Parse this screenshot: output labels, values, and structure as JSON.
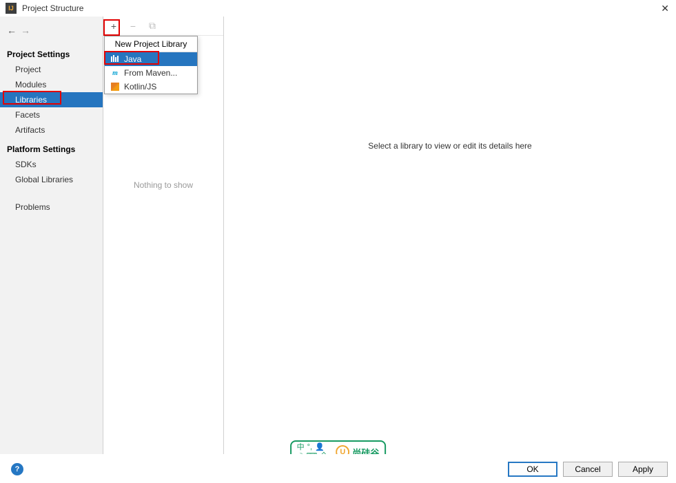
{
  "window": {
    "icon_text": "IJ",
    "title": "Project Structure",
    "close_glyph": "✕"
  },
  "nav": {
    "back_glyph": "←",
    "forward_glyph": "→"
  },
  "sidebar": {
    "section1": "Project Settings",
    "items1": [
      "Project",
      "Modules",
      "Libraries",
      "Facets",
      "Artifacts"
    ],
    "section2": "Platform Settings",
    "items2": [
      "SDKs",
      "Global Libraries"
    ],
    "section3_item": "Problems"
  },
  "toolbar": {
    "add_glyph": "+",
    "remove_glyph": "−",
    "copy_glyph": "⧉"
  },
  "middle": {
    "empty": "Nothing to show"
  },
  "popup": {
    "header": "New Project Library",
    "items": [
      {
        "label": "Java",
        "icon": "java"
      },
      {
        "label": "From Maven...",
        "icon": "maven"
      },
      {
        "label": "Kotlin/JS",
        "icon": "kotlin"
      }
    ]
  },
  "detail": {
    "placeholder": "Select a library to view or edit its details here"
  },
  "footer": {
    "help_glyph": "?",
    "ok": "OK",
    "cancel": "Cancel",
    "apply": "Apply"
  },
  "watermark": {
    "line1a": "中",
    "line1b": "°,",
    "line1c": "👤",
    "line2a": "☽",
    "line2b": "⌨",
    "line2c": "全",
    "logo": "U",
    "text": "尚硅谷"
  }
}
